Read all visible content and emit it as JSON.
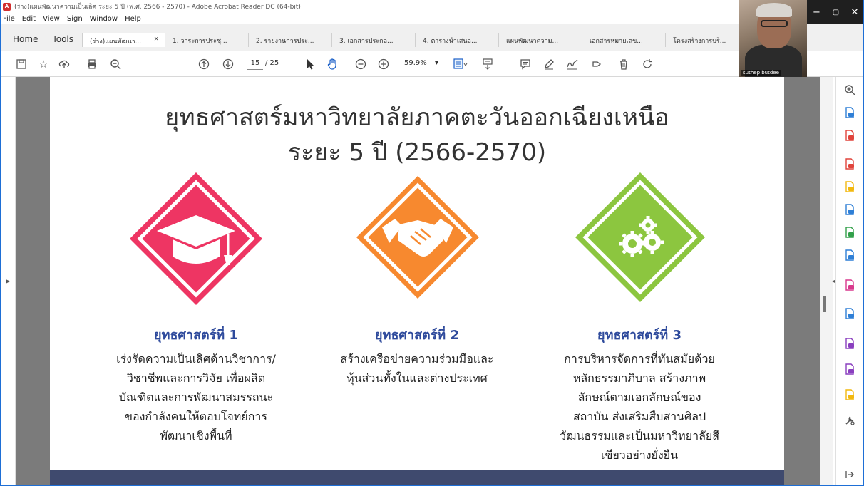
{
  "window": {
    "title": "(ร่าง)แผนพัฒนาความเป็นเลิศ ระยะ 5 ปี (พ.ศ. 2566 - 2570) - Adobe Acrobat Reader DC (64-bit)",
    "minimize": "−",
    "restore": "▢",
    "close": "✕"
  },
  "menu": [
    "File",
    "Edit",
    "View",
    "Sign",
    "Window",
    "Help"
  ],
  "tabs": {
    "home": "Home",
    "tools": "Tools",
    "documents": [
      {
        "label": "(ร่าง)แผนพัฒนา...",
        "active": true,
        "close": "×"
      },
      {
        "label": "1. วาระการประชุ...",
        "active": false
      },
      {
        "label": "2. รายงานการประ...",
        "active": false
      },
      {
        "label": "3. เอกสารประกอ...",
        "active": false
      },
      {
        "label": "4. ตารางนำเสนอ...",
        "active": false
      },
      {
        "label": "แผนพัฒนาความ...",
        "active": false
      },
      {
        "label": "เอกสารหมายเลข...",
        "active": false
      },
      {
        "label": "โครงสร้างการบริ...",
        "active": false
      }
    ]
  },
  "toolbar": {
    "current_page": "15",
    "total_pages": "/ 25",
    "zoom": "59.9%",
    "zoom_caret": "▾",
    "icons": [
      "save-icon",
      "bookmark-star-icon",
      "upload-icon",
      "print-icon",
      "zoom-out-search-icon",
      "page-up-icon",
      "page-down-icon",
      "select-cursor-icon",
      "hand-icon",
      "zoom-minus-icon",
      "zoom-plus-icon",
      "fit-page-icon",
      "scroll-mode-icon",
      "comment-icon",
      "highlight-pen-icon",
      "sign-icon",
      "share-icon",
      "delete-icon",
      "rotate-icon"
    ]
  },
  "webcam": {
    "name": "suthep butdee"
  },
  "slide": {
    "title_line1": "ยุทธศาสตร์มหาวิทยาลัยภาคตะวันออกเฉียงเหนือ",
    "title_line2": "ระยะ 5 ปี (2566-2570)",
    "strategies": [
      {
        "heading": "ยุทธศาสตร์ที่ 1",
        "color": "#ee3563",
        "icon": "graduation-cap-icon",
        "lines": [
          "เร่งรัดความเป็นเลิศด้านวิชาการ/",
          "วิชาชีพและการวิจัย เพื่อผลิต",
          "บัณฑิตและการพัฒนาสมรรถนะ",
          "ของกำลังคนให้ตอบโจทย์การ",
          "พัฒนาเชิงพื้นที่"
        ]
      },
      {
        "heading": "ยุทธศาสตร์ที่ 2",
        "color": "#f7892f",
        "icon": "handshake-icon",
        "lines": [
          "สร้างเครือข่ายความร่วมมือและ",
          "หุ้นส่วนทั้งในและต่างประเทศ"
        ]
      },
      {
        "heading": "ยุทธศาสตร์ที่ 3",
        "color": "#8cc63f",
        "icon": "gears-icon",
        "lines": [
          "การบริหารจัดการที่ทันสมัยด้วย",
          "หลักธรรมาภิบาล สร้างภาพ",
          "ลักษณ์ตามเอกลักษณ์ของ",
          "สถาบัน ส่งเสริมสืบสานศิลป",
          "วัฒนธรรมและเป็นมหาวิทยาลัยสี",
          "เขียวอย่างยั่งยืน"
        ]
      }
    ]
  },
  "right_pane": {
    "tools": [
      "zoom-tool-icon",
      "create-pdf-icon",
      "organize-pages-icon",
      "export-pdf-icon",
      "comment-tool-icon",
      "combine-files-icon",
      "compress-icon",
      "send-review-icon",
      "fill-sign-icon",
      "protect-icon",
      "edit-pdf-icon",
      "request-signature-icon",
      "more-tools-icon",
      "customize-icon",
      "expand-pane-icon"
    ],
    "colors": [
      "#5a5a5a",
      "#2f7fd6",
      "#e0443c",
      "#e0443c",
      "#f2b80f",
      "#2f7fd6",
      "#32a04a",
      "#2f7fd6",
      "#d8398d",
      "#2f7fd6",
      "#8a3fbf",
      "#8a3fbf",
      "#f2b80f",
      "#555555",
      "#555555"
    ]
  }
}
